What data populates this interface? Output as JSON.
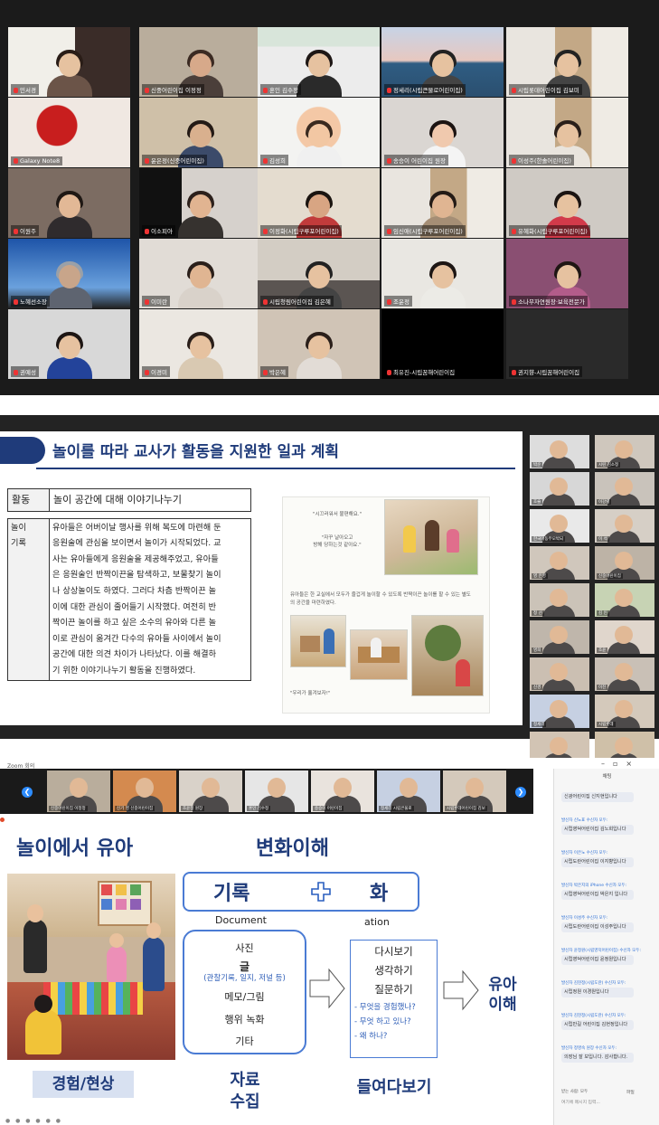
{
  "gallery": {
    "tiles": [
      {
        "name": "민서경",
        "bg": "#cfcac2",
        "skin": "#e6c2a0",
        "hair": "#2a1d17",
        "top": "#6b5448",
        "scene": "room"
      },
      {
        "name": "신중어린이집 이정정",
        "bg": "#b9ad9c",
        "skin": "#d7a98a",
        "hair": "#3b2a22",
        "top": "#4b3f3a",
        "scene": "plain"
      },
      {
        "name": "혼인 김수정",
        "bg": "#e7e7e7",
        "skin": "#e6c2a0",
        "hair": "#1e1715",
        "top": "#2a2a2a",
        "scene": "banner"
      },
      {
        "name": "정세리(시립큰물로어린이집)",
        "bg": "#c6d0e2",
        "skin": "#e6c2a0",
        "hair": "#222",
        "top": "#444",
        "scene": "sea"
      },
      {
        "name": "시립롯데어린이집 김보미",
        "bg": "#d4c9bb",
        "skin": "#e6c2a0",
        "hair": "#222",
        "top": "#444",
        "scene": "door"
      },
      {
        "name": "Galaxy Note8",
        "bg": "#d2c4b4",
        "skin": "#e6c2a0",
        "hair": "#222",
        "top": "#444",
        "scene": "redlamp"
      },
      {
        "name": "윤은정(신중어린이집)",
        "bg": "#cfc0a8",
        "skin": "#d9b08e",
        "hair": "#241a15",
        "top": "#3c4b6a",
        "scene": "plain"
      },
      {
        "name": "김성희",
        "bg": "#f3f3f1",
        "skin": "#f2c7a3",
        "hair": "#3a2a20",
        "top": "#f0f0f0",
        "scene": "avatar"
      },
      {
        "name": "송승이 어린이집 원장",
        "bg": "#dad6d2",
        "skin": "#f0c9ae",
        "hair": "#1c1412",
        "top": "#f4f4f4",
        "scene": "plain"
      },
      {
        "name": "이성주(한솔어린이집)",
        "bg": "#d8d2ca",
        "skin": "#e6c2a0",
        "hair": "#2a1f1a",
        "top": "#e9e4dd",
        "scene": "door"
      },
      {
        "name": "이원주",
        "bg": "#7c6c62",
        "skin": "#e2b896",
        "hair": "#1f1814",
        "top": "#2f2b2d",
        "scene": "plain"
      },
      {
        "name": "이소피아",
        "bg": "#1f1f1f",
        "skin": "#e1b491",
        "hair": "#2c201b",
        "top": "#36322f",
        "scene": "dark"
      },
      {
        "name": "이정화(시립구루포어린이집)",
        "bg": "#e4dccf",
        "skin": "#d8a583",
        "hair": "#1a1410",
        "top": "#c13b3b",
        "scene": "plain"
      },
      {
        "name": "임신애(시립구루포어린이집)",
        "bg": "#cbbba6",
        "skin": "#e0b592",
        "hair": "#241b16",
        "top": "#a58e75",
        "scene": "door"
      },
      {
        "name": "유혜화(시립구루포어린이집)",
        "bg": "#cfcac4",
        "skin": "#e6c2a0",
        "hair": "#1b1412",
        "top": "#d23a4a",
        "scene": "plain"
      },
      {
        "name": "노혜선소장",
        "bg": "#2c5da3",
        "skin": "#c8a58a",
        "hair": "#9aa0a8",
        "top": "#5e6470",
        "scene": "sky"
      },
      {
        "name": "이미란",
        "bg": "#e1dcd6",
        "skin": "#e0b592",
        "hair": "#2a1f1a",
        "top": "#d9d2ca",
        "scene": "plain"
      },
      {
        "name": "시립청림어린이집 김은혜",
        "bg": "#c7c0b8",
        "skin": "#e6c2a0",
        "hair": "#222",
        "top": "#444",
        "scene": "car"
      },
      {
        "name": "조윤정",
        "bg": "#e9e7e2",
        "skin": "#e6c2a0",
        "hair": "#1d1614",
        "top": "#ecebe6",
        "scene": "plain"
      },
      {
        "name": "소나무자연원장·보육전문가",
        "bg": "#8a4f72",
        "skin": "#e6c2a0",
        "hair": "#1f1614",
        "top": "#b35c8a",
        "scene": "plain"
      },
      {
        "name": "권예성",
        "bg": "#d8d8d8",
        "skin": "#e6c2a0",
        "hair": "#1d1614",
        "top": "#23439a",
        "scene": "plain"
      },
      {
        "name": "이경미",
        "bg": "#ebe7e1",
        "skin": "#e6c2a0",
        "hair": "#2a1f1a",
        "top": "#d9c9b2",
        "scene": "plain"
      },
      {
        "name": "박은혜",
        "bg": "#d0c4b6",
        "skin": "#e6c2a0",
        "hair": "#2a1f1a",
        "top": "#e2dcd6",
        "scene": "plain"
      },
      {
        "name": "최유진-시립꿈해어린이집",
        "bg": "#000000",
        "skin": "#000",
        "hair": "#000",
        "top": "#000",
        "scene": "empty"
      },
      {
        "name": "권지향-시립꿈해어린이집",
        "bg": "#2a2a2a",
        "skin": "#000",
        "hair": "#000",
        "top": "#000",
        "scene": "empty"
      }
    ]
  },
  "slide": {
    "title": "놀이를 따라 교사가 활동을 지원한 일과 계획",
    "activity_label": "활동",
    "activity_value": "놀이 공간에 대해 이야기나누기",
    "record_label_1": "놀이",
    "record_label_2": "기록",
    "record_lines": [
      "유아들은 어버이날 행사를 위해 복도에 마련해 둔",
      "응원술에 관심을 보이면서 놀이가 시작되었다. 교",
      "사는 유아들에게 응원술을 제공해주었고, 유아들",
      "은 응원술인 반짝이끈을 탐색하고, 보물찾기 놀이",
      "나 상상놀이도 하였다. 그러다 차츰 반짝이끈 놀",
      "이에 대한 관심이 줄어들기 시작했다. 여전히 반",
      "짝이끈 놀이를 하고 싶은 소수의 유아와 다른 놀",
      "이로 관심이 옮겨간 다수의 유아들 사이에서 놀이",
      "공간에 대한 의견 차이가 나타났다. 이를 해결하",
      "기 위한 이야기나누기 활동을 진행하였다."
    ],
    "photo_quotes": [
      "\"시끄러워서 불편해요.\"",
      "\"자꾸 날아오고",
      "방해 당하는것 같아요.\""
    ],
    "photo_caption": "유아들은 한 교실에서 모두가 즐겁게 놀이할 수 있도록 반짝이끈 놀이를 할 수 있는 별도의 공간을 마련하였다.",
    "photo_quote_bottom": "\"우리가 옮겨보자!\"",
    "footer_chevrons": "❯❯❯❯❯"
  },
  "strip2": {
    "tiles": [
      {
        "name": "박순",
        "bg": "#ddd"
      },
      {
        "name": "시린 김소정",
        "bg": "#cfc7bd"
      },
      {
        "name": "호슬",
        "bg": "#d7d7d7"
      },
      {
        "name": "이강렬",
        "bg": "#c9c3bb"
      },
      {
        "name": "한국아동무모박되",
        "bg": "#e9e9e9"
      },
      {
        "name": "이 석",
        "bg": "#d6cfc6"
      },
      {
        "name": "영 은영",
        "bg": "#d0c7bc"
      },
      {
        "name": "신중어린이집",
        "bg": "#bdb3a6"
      },
      {
        "name": "정 선",
        "bg": "#cbc3b8"
      },
      {
        "name": "김 인",
        "bg": "#c7d3b4"
      },
      {
        "name": "영희",
        "bg": "#bfb6ab"
      },
      {
        "name": "조윤",
        "bg": "#e0d6cc"
      },
      {
        "name": "신경",
        "bg": "#cbbfb2"
      },
      {
        "name": "이진",
        "bg": "#c9c0b6"
      },
      {
        "name": "정세리",
        "bg": "#c6d0e2"
      },
      {
        "name": "시립롯데",
        "bg": "#d4c9bb"
      },
      {
        "name": "Galaxy Note8",
        "bg": "#d2c4b4"
      },
      {
        "name": "윤은정",
        "bg": "#cfc0a8"
      }
    ]
  },
  "zoom": {
    "window_title": "Zoom 회의",
    "strip_tiles": [
      {
        "name": "신중어린이집 이정정",
        "bg": "#b9ad9c"
      },
      {
        "name": "신기 영 신중어린이집",
        "bg": "#d48a4f"
      },
      {
        "name": "조윤정 원장",
        "bg": "#d9d2c9"
      },
      {
        "name": "혼인 김수정",
        "bg": "#e6e6e6"
      },
      {
        "name": "송승이 어린이집",
        "bg": "#e9e3dd"
      },
      {
        "name": "정세리 시립큰물로",
        "bg": "#c6d0e2"
      },
      {
        "name": "시립롯데어린이집 김보",
        "bg": "#d4c9bb"
      }
    ],
    "nav_prev": "❮",
    "nav_next": "❯",
    "left_title": "놀이에서 유아",
    "mid_title": "변화이해",
    "record_word1": "기록",
    "record_word2": "화",
    "record_sub1": "Document",
    "record_sub2": "ation",
    "collect_items": [
      "사진",
      "글",
      "(관찰기록, 일지, 저널 등)",
      "메모/그림",
      "행위 녹화",
      "기타"
    ],
    "reflect_items": [
      "다시보기",
      "생각하기",
      "질문하기"
    ],
    "reflect_questions": [
      "-  무엇을 경험했나?",
      "-  무엇 하고 있나?",
      "-  왜 하나?"
    ],
    "result_line1": "유아",
    "result_line2": "이해",
    "experience_label": "경험/현상",
    "collect_label_1": "자료",
    "collect_label_2": "수집",
    "reflect_label": "들여다보기",
    "chat": {
      "header": "채팅",
      "messages": [
        {
          "from": "",
          "text": "신광어린이집 신지현입니다"
        },
        {
          "from": "발신자 신노표 수신자 모두:",
          "text": "시립영덕어린이집 김노희입니다"
        },
        {
          "from": "발신자 이은노 수신자 모두:",
          "text": "시립도란어린이집 이지향입니다"
        },
        {
          "from": "발신자 박은지의 iPhone 수신자 모두:",
          "text": "시립영덕어린이집 박은지 입니다"
        },
        {
          "from": "발신자 이성주 수신자 모두:",
          "text": "시립도란어린이집 이성주입니다"
        },
        {
          "from": "발신자 윤정원(시립영덕어린이집) 수신자 모두:",
          "text": "시립영덕어린이집 윤정원입니다"
        },
        {
          "from": "발신자 김현정(시립도란) 수신자 모두:",
          "text": "시립정원 이경원입니다"
        },
        {
          "from": "발신자 김현정(시립도란) 수신자 모두:",
          "text": "시립만길 어린이집 김현정입니다"
        },
        {
          "from": "발신자 정영숙 원장 수신자 모두:",
          "text": "의장님 잘 보입니다. 감사합니다."
        }
      ],
      "recipient_label": "받는 사람: 모두",
      "input_placeholder": "여기에 메시지 입력...",
      "file_label": "파일"
    }
  }
}
